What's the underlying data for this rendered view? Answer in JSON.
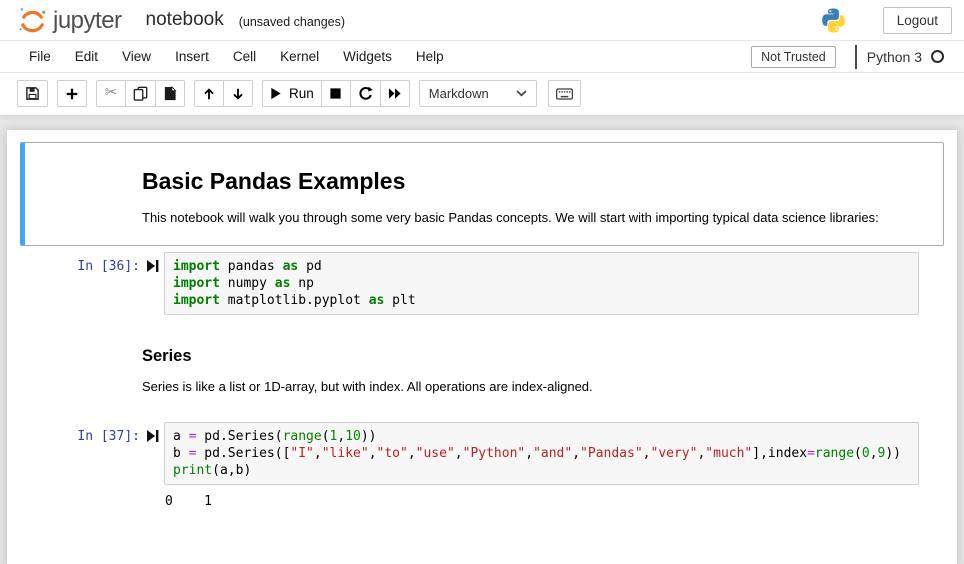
{
  "header": {
    "logo_text": "jupyter",
    "title": "notebook",
    "autosave_status": "(unsaved changes)",
    "logout_label": "Logout"
  },
  "menubar": {
    "items": [
      "File",
      "Edit",
      "View",
      "Insert",
      "Cell",
      "Kernel",
      "Widgets",
      "Help"
    ],
    "trust_label": "Not Trusted",
    "kernel_name": "Python 3"
  },
  "toolbar": {
    "run_label": "Run",
    "cell_type_selected": "Markdown",
    "icons": [
      "save-icon",
      "add-cell-icon",
      "cut-cell-icon",
      "copy-cell-icon",
      "paste-cell-icon",
      "move-cell-up-icon",
      "move-cell-down-icon",
      "run-icon",
      "interrupt-kernel-icon",
      "restart-kernel-icon",
      "restart-run-all-icon",
      "chevron-down-icon",
      "command-palette-icon",
      "kernel-idle-icon",
      "jupyter-logo-icon",
      "python-logo-icon",
      "run-cell-marker-icon"
    ]
  },
  "colors": {
    "brand_orange": "#f37626",
    "prompt_blue": "#303f9f",
    "selected_cell_blue": "#42a5f5",
    "keyword_green": "#008000",
    "string_red": "#ba2121",
    "number_green": "#008800",
    "operator_purple": "#aa22ff",
    "code_bg": "#f7f7f7"
  },
  "cells": [
    {
      "type": "markdown",
      "selected": true,
      "heading": "Basic Pandas Examples",
      "heading_level": 1,
      "body": "This notebook will walk you through some very basic Pandas concepts. We will start with importing typical data science libraries:"
    },
    {
      "type": "code",
      "selected": false,
      "prompt": "In [36]:",
      "lines": [
        [
          {
            "c": "kw",
            "t": "import"
          },
          {
            "c": "pl",
            "t": " pandas "
          },
          {
            "c": "kw",
            "t": "as"
          },
          {
            "c": "pl",
            "t": " pd"
          }
        ],
        [
          {
            "c": "kw",
            "t": "import"
          },
          {
            "c": "pl",
            "t": " numpy "
          },
          {
            "c": "kw",
            "t": "as"
          },
          {
            "c": "pl",
            "t": " np"
          }
        ],
        [
          {
            "c": "kw",
            "t": "import"
          },
          {
            "c": "pl",
            "t": " matplotlib.pyplot "
          },
          {
            "c": "kw",
            "t": "as"
          },
          {
            "c": "pl",
            "t": " plt"
          }
        ]
      ],
      "output": null
    },
    {
      "type": "markdown",
      "selected": false,
      "heading": "Series",
      "heading_level": 3,
      "body": "Series is like a list or 1D-array, but with index. All operations are index-aligned."
    },
    {
      "type": "code",
      "selected": false,
      "prompt": "In [37]:",
      "lines": [
        [
          {
            "c": "pl",
            "t": "a "
          },
          {
            "c": "op",
            "t": "="
          },
          {
            "c": "pl",
            "t": " pd.Series("
          },
          {
            "c": "bi",
            "t": "range"
          },
          {
            "c": "pl",
            "t": "("
          },
          {
            "c": "num",
            "t": "1"
          },
          {
            "c": "pl",
            "t": ","
          },
          {
            "c": "num",
            "t": "10"
          },
          {
            "c": "pl",
            "t": "))"
          }
        ],
        [
          {
            "c": "pl",
            "t": "b "
          },
          {
            "c": "op",
            "t": "="
          },
          {
            "c": "pl",
            "t": " pd.Series(["
          },
          {
            "c": "str",
            "t": "\"I\""
          },
          {
            "c": "pl",
            "t": ","
          },
          {
            "c": "str",
            "t": "\"like\""
          },
          {
            "c": "pl",
            "t": ","
          },
          {
            "c": "str",
            "t": "\"to\""
          },
          {
            "c": "pl",
            "t": ","
          },
          {
            "c": "str",
            "t": "\"use\""
          },
          {
            "c": "pl",
            "t": ","
          },
          {
            "c": "str",
            "t": "\"Python\""
          },
          {
            "c": "pl",
            "t": ","
          },
          {
            "c": "str",
            "t": "\"and\""
          },
          {
            "c": "pl",
            "t": ","
          },
          {
            "c": "str",
            "t": "\"Pandas\""
          },
          {
            "c": "pl",
            "t": ","
          },
          {
            "c": "str",
            "t": "\"very\""
          },
          {
            "c": "pl",
            "t": ","
          },
          {
            "c": "str",
            "t": "\"much\""
          },
          {
            "c": "pl",
            "t": "],index"
          },
          {
            "c": "op",
            "t": "="
          },
          {
            "c": "bi",
            "t": "range"
          },
          {
            "c": "pl",
            "t": "("
          },
          {
            "c": "num",
            "t": "0"
          },
          {
            "c": "pl",
            "t": ","
          },
          {
            "c": "num",
            "t": "9"
          },
          {
            "c": "pl",
            "t": "))"
          }
        ],
        [
          {
            "c": "bi",
            "t": "print"
          },
          {
            "c": "pl",
            "t": "(a,b)"
          }
        ]
      ],
      "output": "0    1"
    }
  ]
}
